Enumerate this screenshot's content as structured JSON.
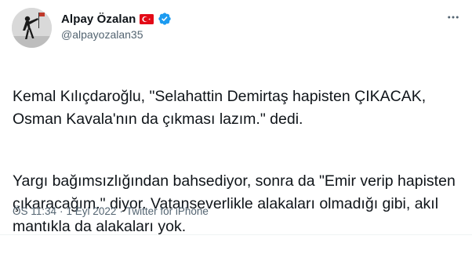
{
  "author": {
    "display_name": "Alpay Özalan",
    "handle": "@alpayozalan35",
    "flag_icon": "turkey-flag-icon",
    "verified_icon": "verified-badge-icon",
    "verified_color": "#1d9bf0",
    "flag_color": "#e30a17"
  },
  "menu": {
    "icon": "more-options-icon"
  },
  "tweet": {
    "paragraphs": [
      "Kemal Kılıçdaroğlu, \"Selahattin Demirtaş hapisten ÇIKACAK, Osman Kavala'nın da çıkması lazım.\" dedi.",
      "Yargı bağımsızlığından bahsediyor, sonra da \"Emir verip hapisten çıkaracağım.\" diyor. Vatanseverlikle alakaları olmadığı gibi, akıl mantıkla da alakaları yok."
    ]
  },
  "meta": {
    "time": "ÖS 11:34",
    "separator_1": "·",
    "date": "1 Eyl 2022",
    "separator_2": "·",
    "source": "Twitter for iPhone"
  }
}
